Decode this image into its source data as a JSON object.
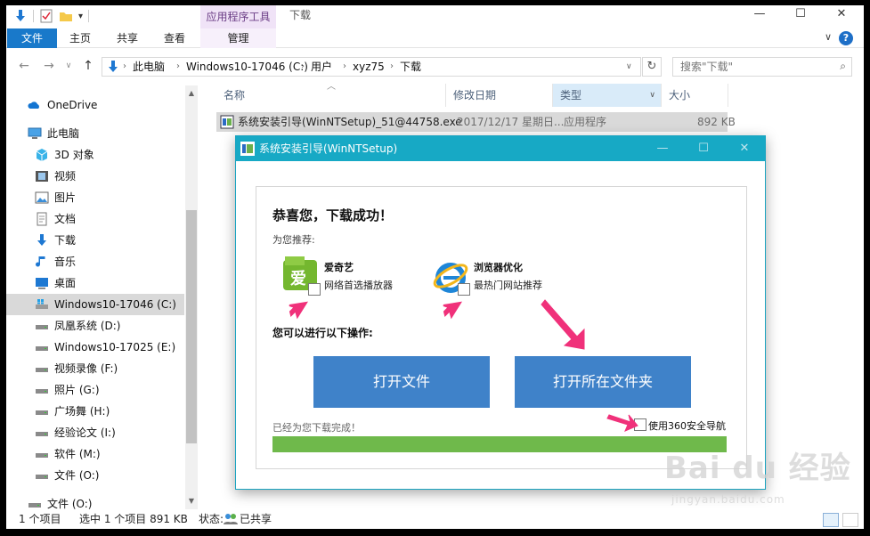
{
  "titlebar": {
    "context_tab": "应用程序工具",
    "window_title": "下载",
    "minimize": "—",
    "maximize": "☐",
    "close": "✕"
  },
  "ribbon": {
    "tabs": [
      {
        "label": "文件"
      },
      {
        "label": "主页"
      },
      {
        "label": "共享"
      },
      {
        "label": "查看"
      },
      {
        "label": "管理"
      }
    ],
    "help": "?",
    "collapse": "∨"
  },
  "address": {
    "segments": [
      "此电脑",
      "Windows10-17046 (C:)",
      "用户",
      "xyz75",
      "下载"
    ],
    "search_placeholder": "搜索\"下载\""
  },
  "navpane": {
    "items": [
      {
        "label": "OneDrive",
        "icon": "onedrive-icon"
      },
      {
        "label": "此电脑",
        "icon": "computer-icon"
      },
      {
        "label": "3D 对象",
        "icon": "3d-objects-icon"
      },
      {
        "label": "视频",
        "icon": "video-icon"
      },
      {
        "label": "图片",
        "icon": "pictures-icon"
      },
      {
        "label": "文档",
        "icon": "documents-icon"
      },
      {
        "label": "下载",
        "icon": "downloads-icon"
      },
      {
        "label": "音乐",
        "icon": "music-icon"
      },
      {
        "label": "桌面",
        "icon": "desktop-icon"
      },
      {
        "label": "Windows10-17046 (C:)",
        "icon": "windows-drive-icon"
      },
      {
        "label": "凤凰系统 (D:)",
        "icon": "drive-icon"
      },
      {
        "label": "Windows10-17025 (E:)",
        "icon": "drive-icon"
      },
      {
        "label": "视频录像 (F:)",
        "icon": "drive-icon"
      },
      {
        "label": "照片 (G:)",
        "icon": "drive-icon"
      },
      {
        "label": "广场舞 (H:)",
        "icon": "drive-icon"
      },
      {
        "label": "经验论文 (I:)",
        "icon": "drive-icon"
      },
      {
        "label": "软件 (M:)",
        "icon": "drive-icon"
      },
      {
        "label": "文件 (O:)",
        "icon": "drive-icon"
      },
      {
        "label": "文件 (O:)",
        "icon": "drive-icon"
      }
    ]
  },
  "columns": {
    "name": "名称",
    "date": "修改日期",
    "type": "类型",
    "size": "大小"
  },
  "file": {
    "name": "系统安装引导(WinNTSetup)_51@44758.exe",
    "date": "2017/12/17 星期日...",
    "type": "应用程序",
    "size": "892 KB"
  },
  "status": {
    "count": "1 个项目",
    "selected": "选中 1 个项目  891 KB",
    "state": "状态:",
    "shared": "已共享"
  },
  "dialog": {
    "title": "系统安装引导(WinNTSetup)",
    "heading": "恭喜您，下载成功！",
    "recommend": "为您推荐:",
    "apps": [
      {
        "name": "爱奇艺",
        "desc": "网络首选播放器"
      },
      {
        "name": "浏览器优化",
        "desc": "最热门网站推荐"
      }
    ],
    "ops_heading": "您可以进行以下操作:",
    "open_file": "打开文件",
    "open_folder": "打开所在文件夹",
    "done_text": "已经为您下载完成！",
    "nav_option": "使用360安全导航",
    "progress": 1.0
  },
  "watermark": {
    "brand": "Bai du 经验",
    "url": "jingyan.baidu.com"
  },
  "colors": {
    "accent": "#1979ca",
    "dialog_title": "#17a9c5",
    "button": "#3f82c9",
    "progress": "#6fb94b",
    "arrow": "#f0317a"
  }
}
